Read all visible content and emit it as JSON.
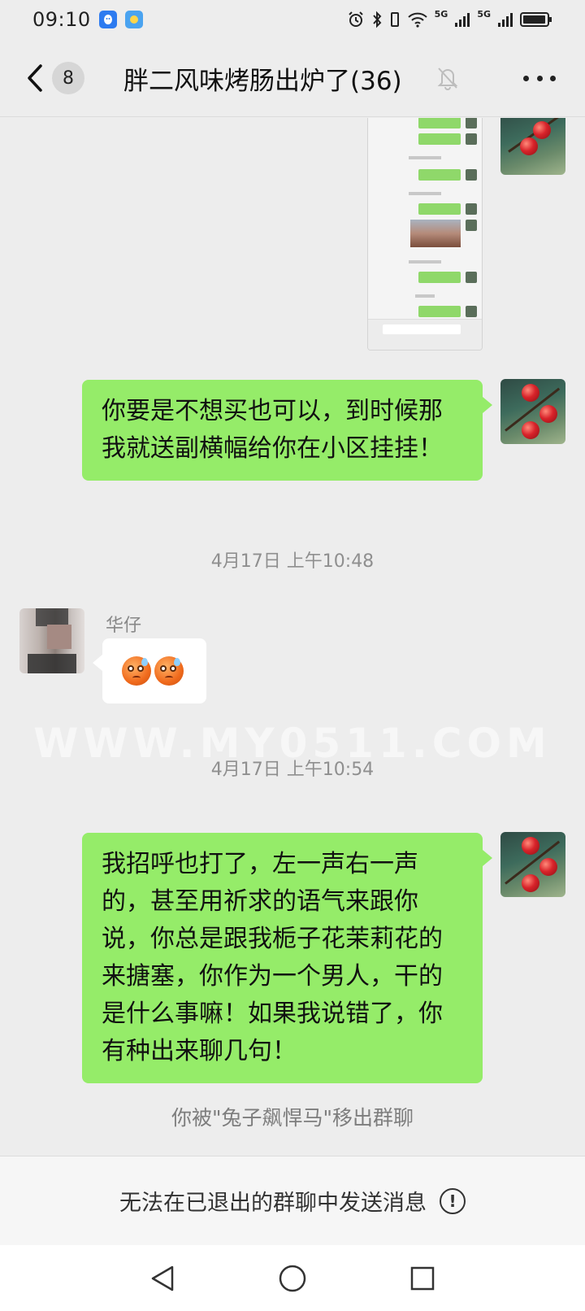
{
  "status_bar": {
    "time": "09:10",
    "network_left": "5G",
    "network_right": "5G"
  },
  "header": {
    "unread_count": "8",
    "title": "胖二风味烤肠出炉了(36)"
  },
  "messages": [
    {
      "type": "image",
      "sender": "self"
    },
    {
      "type": "text",
      "sender": "self",
      "text": "你要是不想买也可以，到时候那我就送副横幅给你在小区挂挂！"
    },
    {
      "type": "timestamp",
      "text": "4月17日 上午10:48"
    },
    {
      "type": "emoji",
      "sender_name": "华仔"
    },
    {
      "type": "timestamp",
      "text": "4月17日 上午10:54"
    },
    {
      "type": "text",
      "sender": "self",
      "text": "我招呼也打了，左一声右一声的，甚至用祈求的语气来跟你说，你总是跟我栀子花茉莉花的来搪塞，你作为一个男人，干的是什么事嘛！如果我说错了，你有种出来聊几句！"
    },
    {
      "type": "system",
      "text": "你被\"兔子飙悍马\"移出群聊"
    }
  ],
  "watermark": "WWW.MY0511.COM",
  "bottom_bar": {
    "text": "无法在已退出的群聊中发送消息",
    "info_glyph": "!"
  },
  "colors": {
    "background": "#ededed",
    "bubble_self": "#95ec69",
    "bubble_other": "#ffffff",
    "muted_text": "#8f8f8f"
  },
  "icons": {
    "back": "chevron-left-icon",
    "mute": "bell-off-icon",
    "more": "more-dots-icon",
    "nav_back": "triangle-back-icon",
    "nav_home": "circle-home-icon",
    "nav_recent": "square-recent-icon"
  }
}
